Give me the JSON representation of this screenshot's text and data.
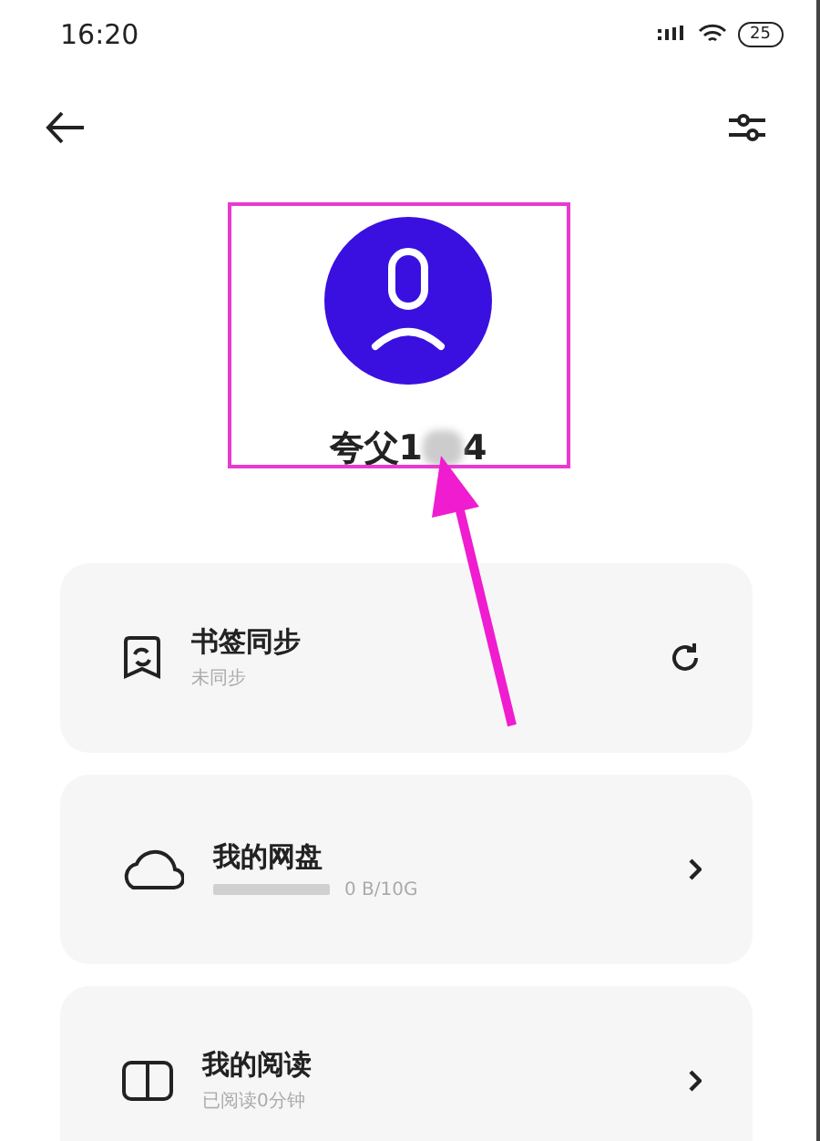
{
  "status_bar": {
    "time": "16:20",
    "battery": "25"
  },
  "profile": {
    "name_start": "夸父1",
    "name_end": "4"
  },
  "cards": [
    {
      "kind": "sync",
      "title": "书签同步",
      "subtitle": "未同步"
    },
    {
      "kind": "storage",
      "title": "我的网盘",
      "usage": "0 B/10G",
      "level": 0
    },
    {
      "kind": "reading",
      "title": "我的阅读",
      "subtitle": "已阅读0分钟"
    }
  ]
}
